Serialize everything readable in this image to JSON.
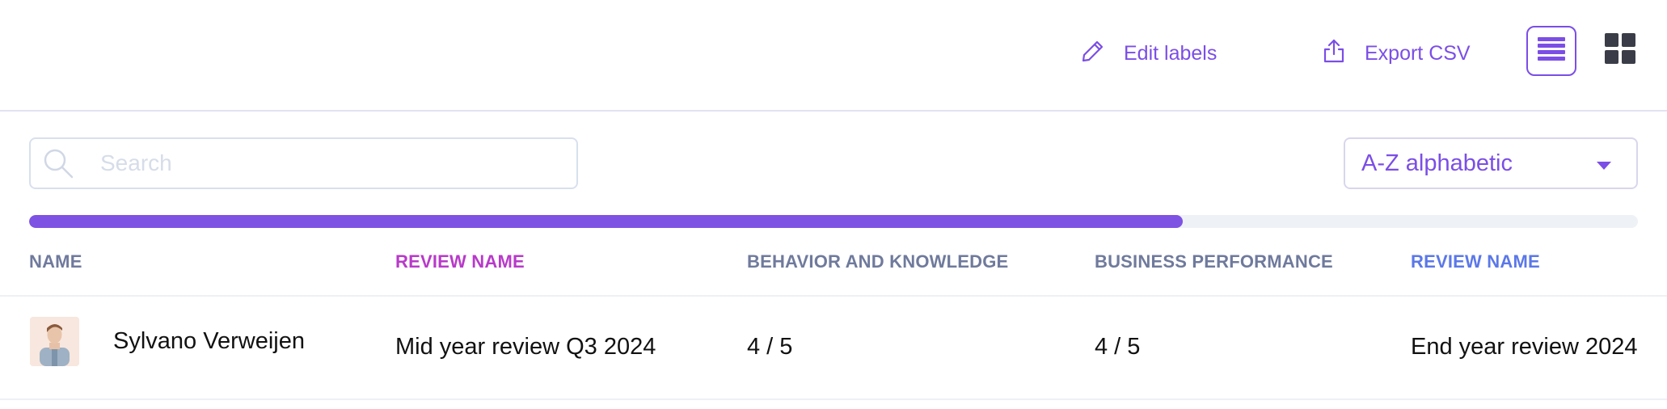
{
  "toolbar": {
    "edit_labels": "Edit labels",
    "export_csv": "Export CSV",
    "accent_color": "#7b4ee6",
    "icons": {
      "edit": "pencil-icon",
      "export": "share-upload-icon",
      "list_view": "list-icon",
      "grid_view": "grid-icon"
    }
  },
  "search": {
    "placeholder": "Search",
    "value": "",
    "icon": "search-icon"
  },
  "sort": {
    "selected": "A-Z alphabetic",
    "icon": "caret-down-icon"
  },
  "progress": {
    "fraction": 0.717,
    "color": "#7e52e3"
  },
  "table": {
    "columns": [
      {
        "label": "NAME",
        "color": "#6f7a9c"
      },
      {
        "label": "REVIEW NAME",
        "color": "#b83ac9"
      },
      {
        "label": "BEHAVIOR AND KNOWLEDGE",
        "color": "#6f7a9c"
      },
      {
        "label": "BUSINESS PERFORMANCE",
        "color": "#6f7a9c"
      },
      {
        "label": "REVIEW NAME",
        "color": "#5b78e8"
      }
    ],
    "rows": [
      {
        "name": "Sylvano Verweijen",
        "review_name": "Mid year review Q3 2024",
        "behavior_and_knowledge": "4 / 5",
        "business_performance": "4 / 5",
        "review_name_2": "End year review 2024"
      }
    ]
  }
}
